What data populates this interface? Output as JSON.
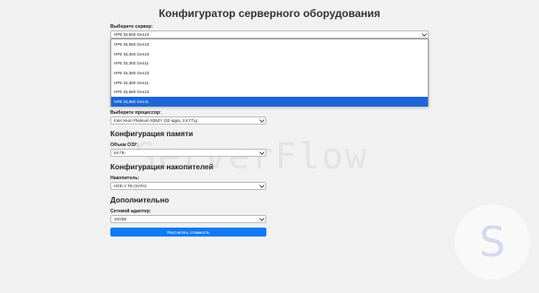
{
  "page": {
    "title": "Конфигуратор серверного оборудования",
    "watermark": "ServerFlow",
    "logo_letter": "S"
  },
  "server": {
    "label": "Выберите сервер:",
    "value": "HPE DL560 Gen10",
    "options": [
      "HPE DL560 Gen10",
      "HPE DL360 Gen10",
      "HPE DL360 Gen11",
      "HPE DL380 Gen10",
      "HPE DL380 Gen11",
      "HPE DL580 Gen10",
      "HPE DL560 Gen11"
    ],
    "highlighted_option": "HPE DL560 Gen11"
  },
  "processor": {
    "label": "Выберите процессор:",
    "value": "Intel Xeon Platinum 8352Y (32 ядра, 2.8 ГГц)"
  },
  "memory": {
    "section_title": "Конфигурация памяти",
    "label": "Объем ОЗУ:",
    "value": "64 ГБ"
  },
  "storage": {
    "section_title": "Конфигурация накопителей",
    "label": "Накопитель:",
    "value": "HDD 2 ТБ (SATA)"
  },
  "extra": {
    "section_title": "Дополнительно",
    "label": "Сетевой адаптер:",
    "value": "10GbE"
  },
  "actions": {
    "calculate_label": "Рассчитать стоимость"
  },
  "colors": {
    "accent": "#1279f2",
    "selected_option": "#1e66d6",
    "background": "#f1f1f2"
  }
}
